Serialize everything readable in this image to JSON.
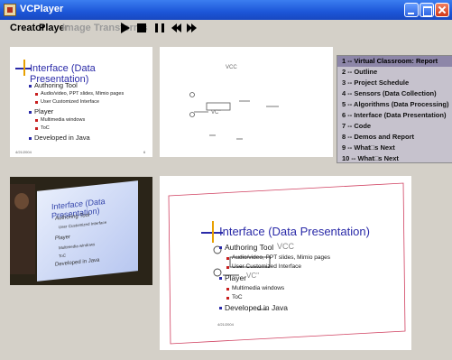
{
  "window": {
    "title": "VCPlayer"
  },
  "menu": {
    "creator": "Creator",
    "player": "Player",
    "image_transforms": "Image Transforms"
  },
  "toolbar": {
    "icons": [
      "play-icon",
      "stop-icon",
      "pause-icon",
      "previous-icon",
      "next-icon"
    ]
  },
  "slide": {
    "title": "Interface (Data Presentation)",
    "bullets": [
      {
        "text": "Authoring Tool",
        "level": 1
      },
      {
        "text": "Audio/video, PPT slides, Mimio pages",
        "level": 2
      },
      {
        "text": "User Customized Interface",
        "level": 2
      },
      {
        "text": "Player",
        "level": 1
      },
      {
        "text": "Multimedia windows",
        "level": 2
      },
      {
        "text": "ToC",
        "level": 2
      },
      {
        "text": "Developed in Java",
        "level": 1
      }
    ],
    "date": "4/21/2004",
    "page": "6"
  },
  "ink": {
    "annotation_1": "VCC",
    "annotation_2": "VC''"
  },
  "toc": {
    "items": [
      "1 -- Virtual Classroom: Report",
      "2 -- Outline",
      "3 -- Project Schedule",
      "4 -- Sensors (Data Collection)",
      "5 -- Algorithms (Data Processing)",
      "6 -- Interface (Data Presentation)",
      "7 -- Code",
      "8 -- Demos and Report",
      "9 -- What□s Next",
      "10 -- What□s Next"
    ],
    "selected_index": 0
  },
  "colors": {
    "titlebar": "#1c56d8",
    "slide_title": "#2a2aa8",
    "toc_bg": "#c6c2cd",
    "toc_selected": "#8d86a8"
  }
}
